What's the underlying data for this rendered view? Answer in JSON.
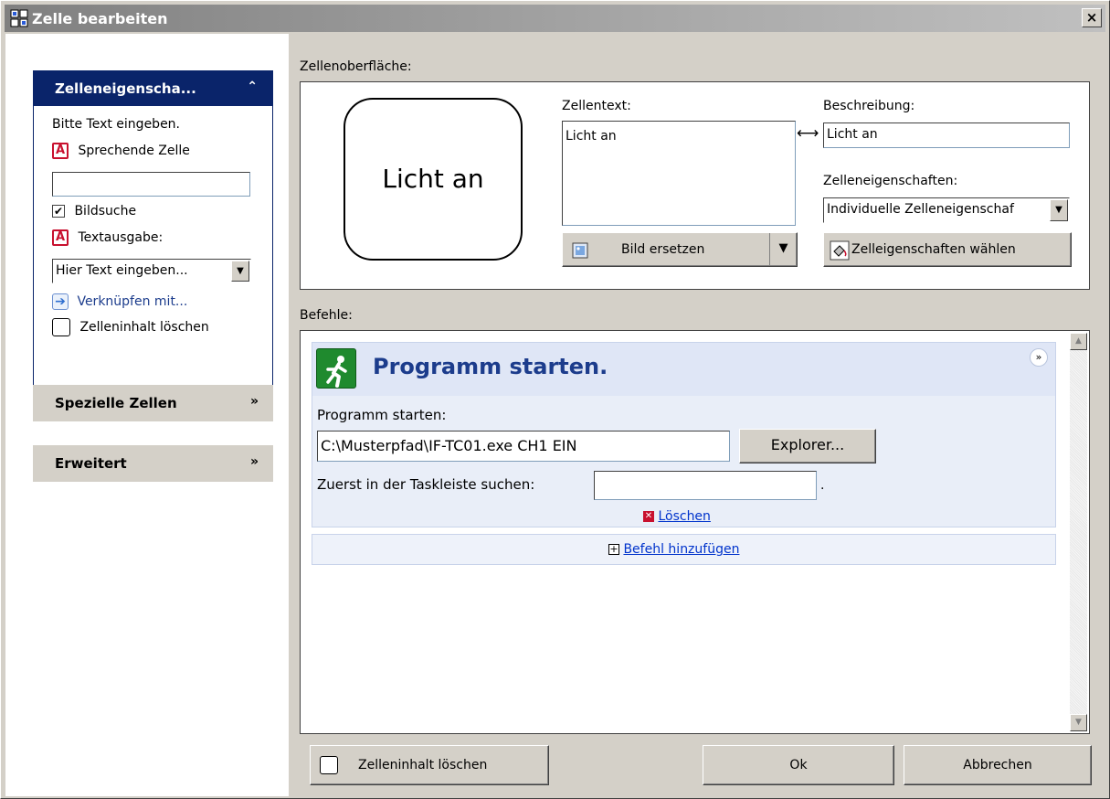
{
  "window": {
    "title": "Zelle bearbeiten",
    "close_label": "×"
  },
  "left": {
    "properties": {
      "header": "Zelleneigenscha...",
      "prompt": "Bitte Text eingeben.",
      "speaking_cell_label": "Sprechende Zelle",
      "speaking_cell_value": "",
      "image_search_label": "Bildsuche",
      "image_search_checked": true,
      "text_output_label": "Textausgabe:",
      "text_output_value": "Hier Text eingeben...",
      "link_label": "Verknüpfen mit...",
      "clear_label": "Zelleninhalt löschen"
    },
    "special_cells": "Spezielle Zellen",
    "advanced": "Erweitert"
  },
  "surface": {
    "label": "Zellenoberfläche:",
    "preview_text": "Licht an",
    "cell_text_label": "Zellentext:",
    "cell_text_value": "Licht an",
    "description_label": "Beschreibung:",
    "description_value": "Licht an",
    "props_label": "Zelleneigenschaften:",
    "props_value": "Individuelle Zelleneigenschaf",
    "replace_image_btn": "Bild ersetzen",
    "choose_props_btn": "Zelleigenschaften wählen"
  },
  "commands": {
    "label": "Befehle:",
    "card_title": "Programm starten.",
    "program_label": "Programm starten:",
    "program_value": "C:\\Musterpfad\\IF-TC01.exe CH1 EIN",
    "explorer_btn": "Explorer...",
    "taskbar_label": "Zuerst in der Taskleiste suchen:",
    "taskbar_value": "",
    "taskbar_suffix": ".",
    "delete_link": "Löschen",
    "add_command_link": "Befehl hinzufügen"
  },
  "footer": {
    "clear_btn": "Zelleninhalt löschen",
    "ok_btn": "Ok",
    "cancel_btn": "Abbrechen"
  },
  "icons": {
    "collapse": "chevron-double-up-icon",
    "expand": "chevron-double-down-icon",
    "run": "running-man-icon"
  },
  "colors": {
    "accent": "#0a246a",
    "command_title": "#1c3c8c",
    "run_icon": "#1f8a2e",
    "text_icon": "#c8102e"
  }
}
